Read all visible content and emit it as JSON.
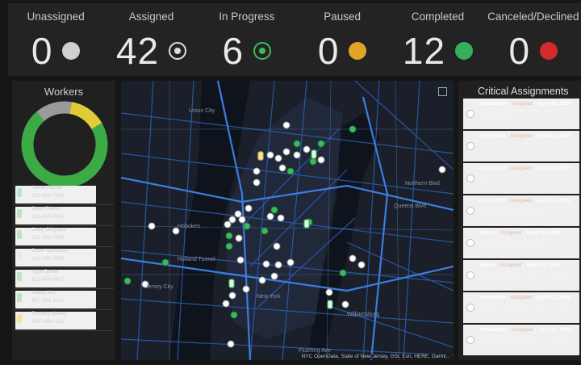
{
  "stats": [
    {
      "label": "Unassigned",
      "value": "0",
      "indicator": "unassigned-dot-icon",
      "color": "#d0d0d0"
    },
    {
      "label": "Assigned",
      "value": "42",
      "indicator": "assigned-ring-icon",
      "color": "#d0d0d0"
    },
    {
      "label": "In Progress",
      "value": "6",
      "indicator": "in-progress-ring-icon",
      "color": "#3dbb5a"
    },
    {
      "label": "Paused",
      "value": "0",
      "indicator": "paused-dot-icon",
      "color": "#e0a526"
    },
    {
      "label": "Completed",
      "value": "12",
      "indicator": "completed-dot-icon",
      "color": "#33b158"
    },
    {
      "label": "Canceled/Declined",
      "value": "0",
      "indicator": "canceled-dot-icon",
      "color": "#d42a2a"
    }
  ],
  "workers": {
    "title": "Workers",
    "donut_segments": [
      {
        "status": "green",
        "fraction": 0.72,
        "color": "#3cab46"
      },
      {
        "status": "gray",
        "fraction": 0.14,
        "color": "#9a9a9a"
      },
      {
        "status": "yellow",
        "fraction": 0.14,
        "color": "#e2cc36"
      }
    ],
    "list": [
      {
        "name": "Aaron Parker",
        "phone": "123-456-7890"
      },
      {
        "name": "Brent Pierce",
        "phone": "123-654-7890"
      },
      {
        "name": "Craig Gillgrass",
        "phone": "321-456-7890"
      },
      {
        "name": "Dave Nyenhuis",
        "phone": "321-789-4560"
      },
      {
        "name": "Kylie Donia",
        "phone": "321-654-0987"
      },
      {
        "name": "Mabel Nio",
        "phone": "987-654-3210"
      },
      {
        "name": "Timothy Money",
        "phone": "0987-654-321"
      }
    ]
  },
  "map": {
    "attribution": "NYC OpenData, State of New Jersey, GSI, Esri, HERE, Garmi...",
    "labels": [
      "Union City",
      "Hoboken",
      "New York",
      "Williamsburg",
      "Flushing Ave",
      "Northern Blvd",
      "Queens Blvd",
      "Holland Tunnel",
      "Jersey City"
    ]
  },
  "critical": {
    "title": "Critical Assignments",
    "items": [
      {
        "type": "Installation",
        "status": "Assigned",
        "date": "April 18, 2018",
        "address": "Garcinia, 233 Bowery, New York, NY 10002, USA"
      },
      {
        "type": "Inspection",
        "status": "Assigned",
        "date": "April 18, 2018",
        "address": "8th Ave, New York, NY 10011, USA"
      },
      {
        "type": "Inspection",
        "status": "Assigned",
        "date": "April 18, 2018",
        "address": "421 Hudson St, New York, NY 10014, USA"
      },
      {
        "type": "Inspection",
        "status": "Assigned",
        "date": "April 18, 2018",
        "address": "Manhattan Stone Industry, 195 Bowery, New York, NY 10002, USA"
      },
      {
        "type": "Repair",
        "status": "Assigned",
        "date": "April 19, 2018",
        "address": "Nine Missions, 61 Columbus Ave, New York, NY 10023, USA"
      },
      {
        "type": "Repair",
        "status": "Assigned",
        "date": "April 20, 2018",
        "address": "Home Scholar, 265 Kent Ave, Brooklyn, NY 11249, USA"
      },
      {
        "type": "Inspection",
        "status": "Assigned",
        "date": "April 20, 2018",
        "address": "414-932 3rd Ave, New York, NY 10022, USA"
      },
      {
        "type": "Installation",
        "status": "Assigned",
        "date": "April 20, 2018",
        "address": "ASW ENERGY, 1625 6th Ave, New York, NY 10019, USA"
      }
    ]
  }
}
